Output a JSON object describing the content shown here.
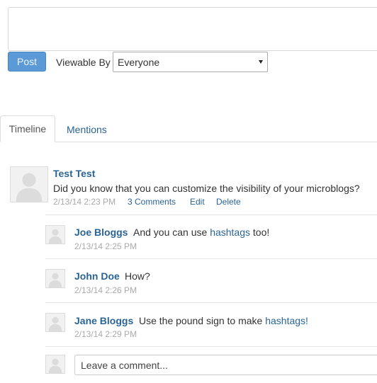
{
  "composer": {
    "placeholder": ""
  },
  "post_button": "Post",
  "viewable_by": {
    "label": "Viewable By",
    "selected": "Everyone"
  },
  "tabs": [
    {
      "label": "Timeline",
      "active": true
    },
    {
      "label": "Mentions",
      "active": false
    }
  ],
  "post": {
    "author": "Test Test",
    "text": "Did you know that you can customize the visibility of your microblogs?",
    "date": "2/13/14 2:23 PM",
    "comments_link": "3 Comments",
    "edit_link": "Edit",
    "delete_link": "Delete"
  },
  "comments": [
    {
      "author": "Joe Bloggs",
      "text_before": "And you can use ",
      "link": "hashtags",
      "text_after": " too!",
      "date": "2/13/14 2:25 PM"
    },
    {
      "author": "John Doe",
      "text_before": "How?",
      "link": "",
      "text_after": "",
      "date": "2/13/14 2:26 PM"
    },
    {
      "author": "Jane Bloggs",
      "text_before": "Use the pound sign to make ",
      "link": "hashtags!",
      "text_after": "",
      "date": "2/13/14 2:29 PM"
    }
  ],
  "comment_input": {
    "placeholder": "Leave a comment..."
  },
  "colors": {
    "link": "#2a6496",
    "post_button": "#5b9ad6",
    "muted": "#aaaaaa"
  },
  "icons": {
    "avatar": "default-user-avatar-icon",
    "select_caret": "caret-down-icon"
  }
}
